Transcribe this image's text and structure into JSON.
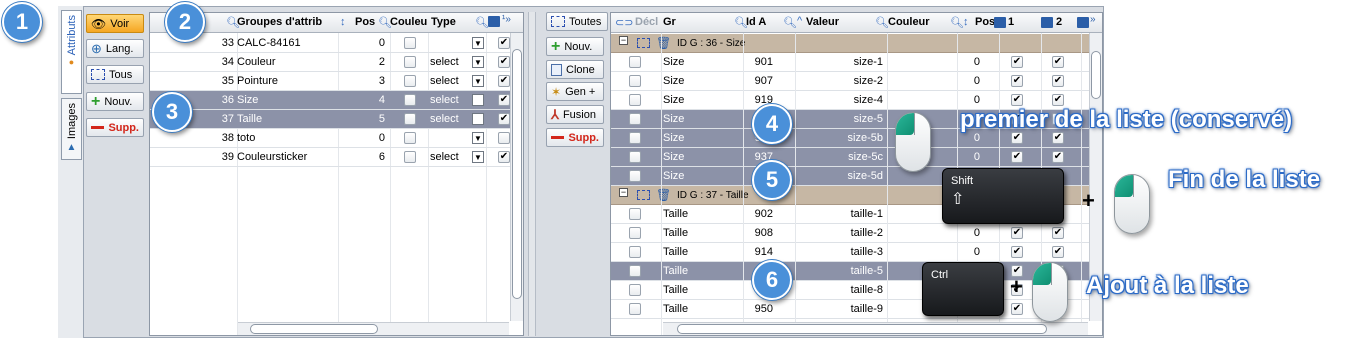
{
  "left_tabs": {
    "attributs": "Attributs",
    "images": "Images"
  },
  "left_toolbar": {
    "voir": "Voir",
    "lang": "Lang.",
    "tous": "Tous",
    "nouv": "Nouv.",
    "supp": "Supp."
  },
  "left_grid": {
    "headers": {
      "groupes": "Groupes d'attrib",
      "pos": "Pos",
      "couleur": "Couleu",
      "type": "Type"
    },
    "rows": [
      {
        "id": "33",
        "name": "CALC-84161",
        "pos": "0",
        "type": "",
        "chk": true,
        "sel": false
      },
      {
        "id": "34",
        "name": "Couleur",
        "pos": "2",
        "type": "select",
        "chk": true,
        "sel": false
      },
      {
        "id": "35",
        "name": "Pointure",
        "pos": "3",
        "type": "select",
        "chk": true,
        "sel": false
      },
      {
        "id": "36",
        "name": "Size",
        "pos": "4",
        "type": "select",
        "chk": true,
        "sel": true
      },
      {
        "id": "37",
        "name": "Taille",
        "pos": "5",
        "type": "select",
        "chk": true,
        "sel": true
      },
      {
        "id": "38",
        "name": "toto",
        "pos": "0",
        "type": "",
        "chk": false,
        "sel": false
      },
      {
        "id": "39",
        "name": "Couleursticker",
        "pos": "6",
        "type": "select",
        "chk": true,
        "sel": false
      }
    ]
  },
  "right_toolbar": {
    "toutes": "Toutes",
    "nouv": "Nouv.",
    "clone": "Clone",
    "gen": "Gen +",
    "fusion": "Fusion",
    "supp": "Supp."
  },
  "right_grid": {
    "headers": {
      "decl": "Décl",
      "gr": "Gr",
      "ida": "Id A",
      "valeur": "Valeur",
      "couleur": "Couleur",
      "pos": "Pos",
      "c1": "1",
      "c2": "2"
    },
    "groups": [
      {
        "label": "ID G : 36 - Size",
        "rows": [
          {
            "gr": "Size",
            "ida": "901",
            "val": "size-1",
            "pos": "0",
            "sel": false
          },
          {
            "gr": "Size",
            "ida": "907",
            "val": "size-2",
            "pos": "0",
            "sel": false
          },
          {
            "gr": "Size",
            "ida": "919",
            "val": "size-4",
            "pos": "0",
            "sel": false
          },
          {
            "gr": "Size",
            "ida": "",
            "val": "size-5",
            "pos": "0",
            "sel": true
          },
          {
            "gr": "Size",
            "ida": "931",
            "val": "size-5b",
            "pos": "0",
            "sel": true
          },
          {
            "gr": "Size",
            "ida": "937",
            "val": "size-5c",
            "pos": "0",
            "sel": true
          },
          {
            "gr": "Size",
            "ida": "",
            "val": "size-5d",
            "pos": "0",
            "sel": true
          }
        ]
      },
      {
        "label": "ID G : 37 - Taille",
        "rows": [
          {
            "gr": "Taille",
            "ida": "902",
            "val": "taille-1",
            "pos": "0",
            "sel": false
          },
          {
            "gr": "Taille",
            "ida": "908",
            "val": "taille-2",
            "pos": "0",
            "sel": false
          },
          {
            "gr": "Taille",
            "ida": "914",
            "val": "taille-3",
            "pos": "0",
            "sel": false
          },
          {
            "gr": "Taille",
            "ida": "",
            "val": "taille-5",
            "pos": "",
            "sel": true
          },
          {
            "gr": "Taille",
            "ida": "",
            "val": "taille-8",
            "pos": "",
            "sel": false
          },
          {
            "gr": "Taille",
            "ida": "950",
            "val": "taille-9",
            "pos": "",
            "sel": false
          }
        ]
      }
    ]
  },
  "annotations": {
    "badges": [
      "1",
      "2",
      "3",
      "4",
      "5",
      "6"
    ],
    "premier": "premier de la liste (conservé)",
    "fin": "Fin de la liste",
    "ajout": "Ajout à la liste",
    "shift": "Shift",
    "shift_arrow": "⇧",
    "ctrl": "Ctrl",
    "plus": "+"
  },
  "colors": {
    "accent": "#4a90d9",
    "selection": "#8c92a8",
    "group_band": "#c6b7a4",
    "voir_active": "#f5a623"
  }
}
